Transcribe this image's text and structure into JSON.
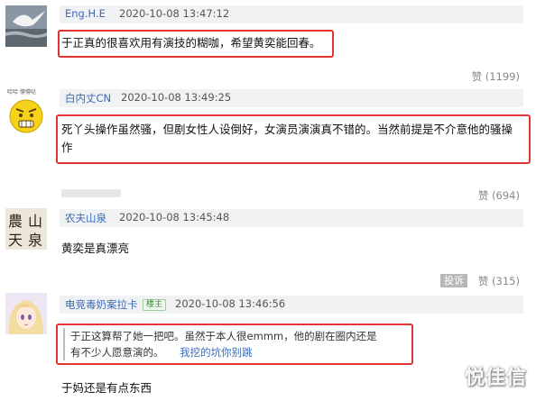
{
  "comments": [
    {
      "user": "Eng.H.E",
      "time": "2020-10-08 13:47:12",
      "text": "于正真的很喜欢用有演技的糊咖，希望黄奕能回春。",
      "likes": "(1199)",
      "avatar_icon": "bird-on-water-avatar-icon"
    },
    {
      "user": "白内丈CN",
      "time": "2020-10-08 13:49:25",
      "text_line1": "死丫头操作虽然骚，但剧女性人设倒好，女演员演演真不错的。当然前提是不介意他的骚操",
      "text_line2": "作",
      "likes": "(694)",
      "avatar_caption": "哈哈 懵懵哒",
      "avatar_icon": "angry-emoji-avatar-icon"
    },
    {
      "user": "农夫山泉",
      "time": "2020-10-08 13:45:48",
      "text": "黄奕是真漂亮",
      "likes": "(315)",
      "avatar_text": "農山天泉",
      "report": "投诉"
    },
    {
      "user": "电竞毒奶案拉卡",
      "badge": "楼主",
      "time": "2020-10-08 13:46:56",
      "quote_line1": "于正这算帮了她一把吧。虽然于本人很emmm，他的剧在圈内还是",
      "quote_line2": "有不少人愿意演的。",
      "quote_link": "我挖的坑你别跳",
      "text": "于妈还是有点东西",
      "avatar_icon": "anime-girl-avatar-icon"
    }
  ],
  "like_label": "赞",
  "watermark": "悦佳信",
  "colors": {
    "highlight": "#e03434",
    "link": "#3a6ab7",
    "header_bg": "#f0f2f4"
  }
}
